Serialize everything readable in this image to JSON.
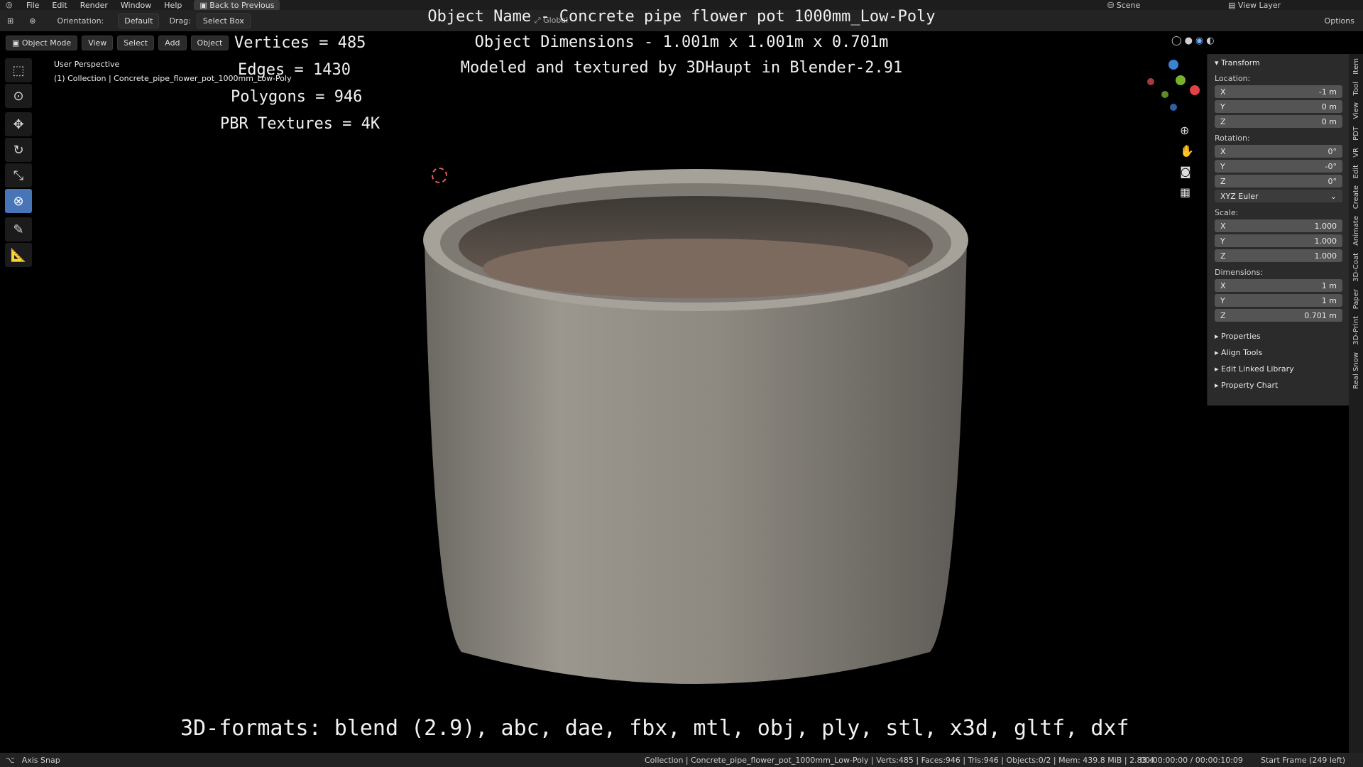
{
  "topbar": {
    "menu": [
      "File",
      "Edit",
      "Render",
      "Window",
      "Help"
    ],
    "back_button": "Back to Previous",
    "scene": "Scene",
    "view_layer": "View Layer"
  },
  "toolbar": {
    "orientation_label": "Orientation:",
    "orientation_value": "Default",
    "drag_label": "Drag:",
    "drag_value": "Select Box",
    "global_value": "Global",
    "options_label": "Options"
  },
  "header": {
    "mode": "Object Mode",
    "menus": [
      "View",
      "Select",
      "Add",
      "Object"
    ]
  },
  "viewport": {
    "perspective": "User Perspective",
    "collection_line": "(1) Collection | Concrete_pipe_flower_pot_1000mm_Low-Poly",
    "overlay_left": [
      "Vertices = 485",
      "Edges = 1430",
      "Polygons = 946",
      "PBR Textures = 4K"
    ],
    "overlay_center": [
      "Object Name - Concrete pipe flower pot 1000mm_Low-Poly",
      "Object Dimensions -  1.001m x 1.001m x 0.701m",
      "Modeled and textured by 3DHaupt in Blender-2.91"
    ],
    "formats_line": "3D-formats: blend (2.9), abc, dae, fbx, mtl, obj, ply, stl, x3d, gltf, dxf"
  },
  "sidebar": {
    "transform_title": "Transform",
    "location_label": "Location:",
    "location": [
      {
        "k": "X",
        "v": "-1 m"
      },
      {
        "k": "Y",
        "v": "0 m"
      },
      {
        "k": "Z",
        "v": "0 m"
      }
    ],
    "rotation_label": "Rotation:",
    "rotation": [
      {
        "k": "X",
        "v": "0°"
      },
      {
        "k": "Y",
        "v": "-0°"
      },
      {
        "k": "Z",
        "v": "0°"
      }
    ],
    "rotation_mode": "XYZ Euler",
    "scale_label": "Scale:",
    "scale": [
      {
        "k": "X",
        "v": "1.000"
      },
      {
        "k": "Y",
        "v": "1.000"
      },
      {
        "k": "Z",
        "v": "1.000"
      }
    ],
    "dimensions_label": "Dimensions:",
    "dimensions": [
      {
        "k": "X",
        "v": "1 m"
      },
      {
        "k": "Y",
        "v": "1 m"
      },
      {
        "k": "Z",
        "v": "0.701 m"
      }
    ],
    "collapsed": [
      "Properties",
      "Align Tools",
      "Edit Linked Library",
      "Property Chart"
    ]
  },
  "tabs": [
    "Item",
    "Tool",
    "View",
    "PDT",
    "VR",
    "Edit",
    "Create",
    "Animate",
    "3D-Coat",
    "Paper",
    "3D-Print",
    "Real Snow"
  ],
  "statusbar": {
    "left": "Axis Snap",
    "collection_info": "Collection | Concrete_pipe_flower_pot_1000mm_Low-Poly | Verts:485 | Faces:946 | Tris:946 | Objects:0/2 | Mem: 439.8 MiB | 2.83.4",
    "time": "00:00:00:00 / 00:00:10:09",
    "start_frame": "Start Frame (249 left)"
  },
  "colors": {
    "accent": "#4775b8",
    "pot": "#8f8b84"
  }
}
